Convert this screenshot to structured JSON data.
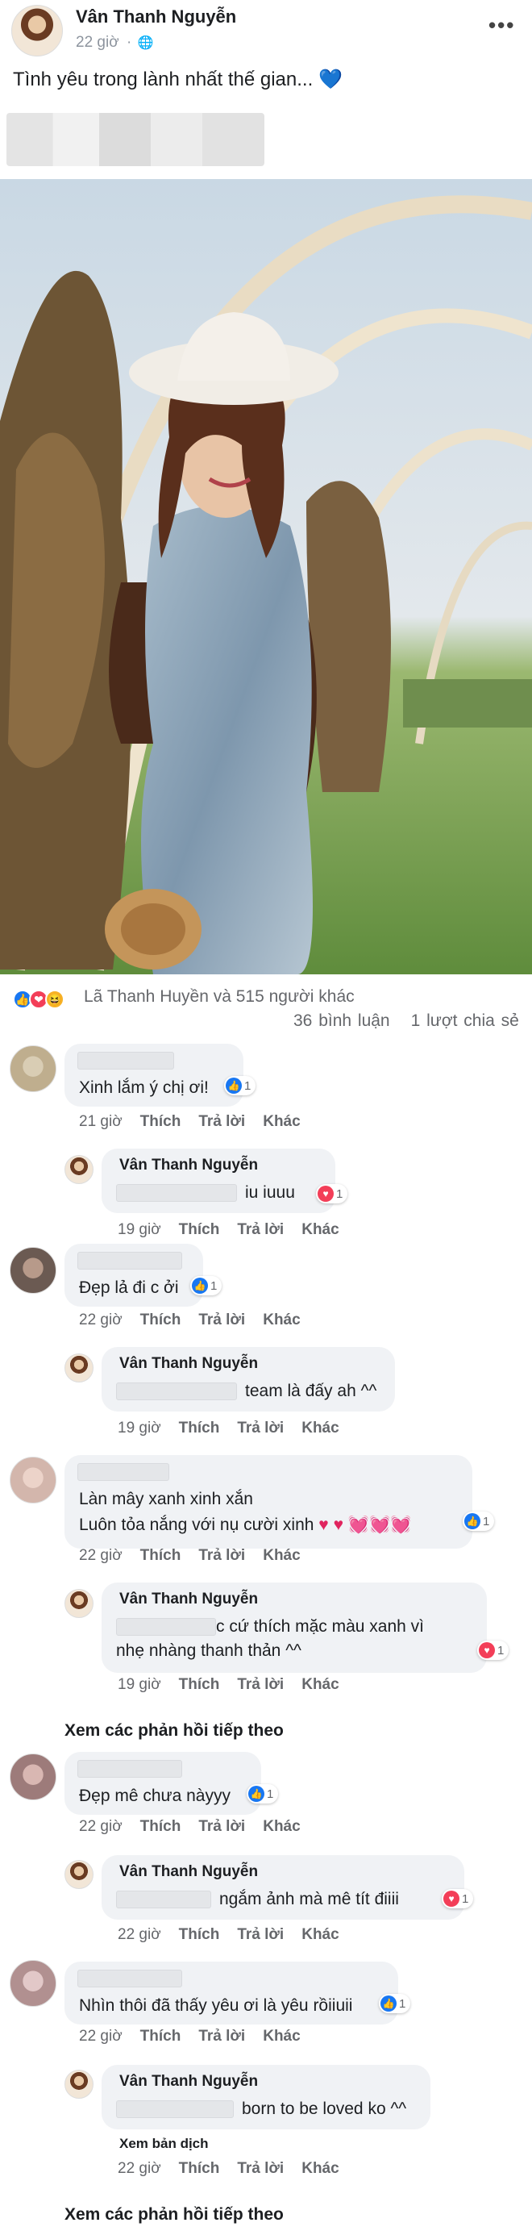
{
  "post": {
    "author": "Vân Thanh Nguyễn",
    "time": "22 giờ",
    "privacy_icon": "globe-icon",
    "text": "Tình yêu trong lành nhất thế gian...",
    "emoji": "💙",
    "photo_caption": ""
  },
  "reactions": {
    "icons": [
      "👍",
      "❤",
      "😆"
    ],
    "summary": "Lã Thanh Huyền và 515 người khác",
    "comments": "36 bình luận",
    "shares": "1 lượt chia sẻ"
  },
  "labels": {
    "like": "Thích",
    "reply": "Trả lời",
    "other": "Khác",
    "more_replies": "Xem các phản hồi tiếp theo",
    "translate": "Xem bản dịch"
  },
  "comments": [
    {
      "text": "Xinh lắm ý chị ơi!",
      "time": "21 giờ",
      "react": "1"
    },
    {
      "reply_author": "Vân Thanh Nguyễn",
      "text": "iu iuuu",
      "time": "19 giờ",
      "react": "1"
    },
    {
      "text": "Đẹp lả đi c ởi",
      "time": "22 giờ",
      "react": "1"
    },
    {
      "reply_author": "Vân Thanh Nguyễn",
      "text": "team là đấy ah ^^",
      "time": "19 giờ"
    },
    {
      "text_line1": "Làn mây xanh xinh xắn",
      "text_line2": "Luôn tỏa nắng với nụ cười xinh",
      "hearts": "♥ ♥ 💓💓💓",
      "time": "22 giờ",
      "react": "1"
    },
    {
      "reply_author": "Vân Thanh Nguyễn",
      "text_line1": "c cứ thích mặc màu xanh vì",
      "text_line2": "nhẹ nhàng thanh thản ^^",
      "time": "19 giờ",
      "react": "1"
    },
    {
      "text": "Đẹp mê chưa nàyyy",
      "time": "22 giờ",
      "react": "1"
    },
    {
      "reply_author": "Vân Thanh Nguyễn",
      "text": "ngắm ảnh mà mê tít điiii",
      "time": "22 giờ",
      "react": "1"
    },
    {
      "text": "Nhìn thôi đã thấy yêu ơi là yêu rồiiuii",
      "time": "22 giờ",
      "react": "1"
    },
    {
      "reply_author": "Vân Thanh Nguyễn",
      "text": "born to be loved ko ^^",
      "time": "22 giờ"
    }
  ]
}
